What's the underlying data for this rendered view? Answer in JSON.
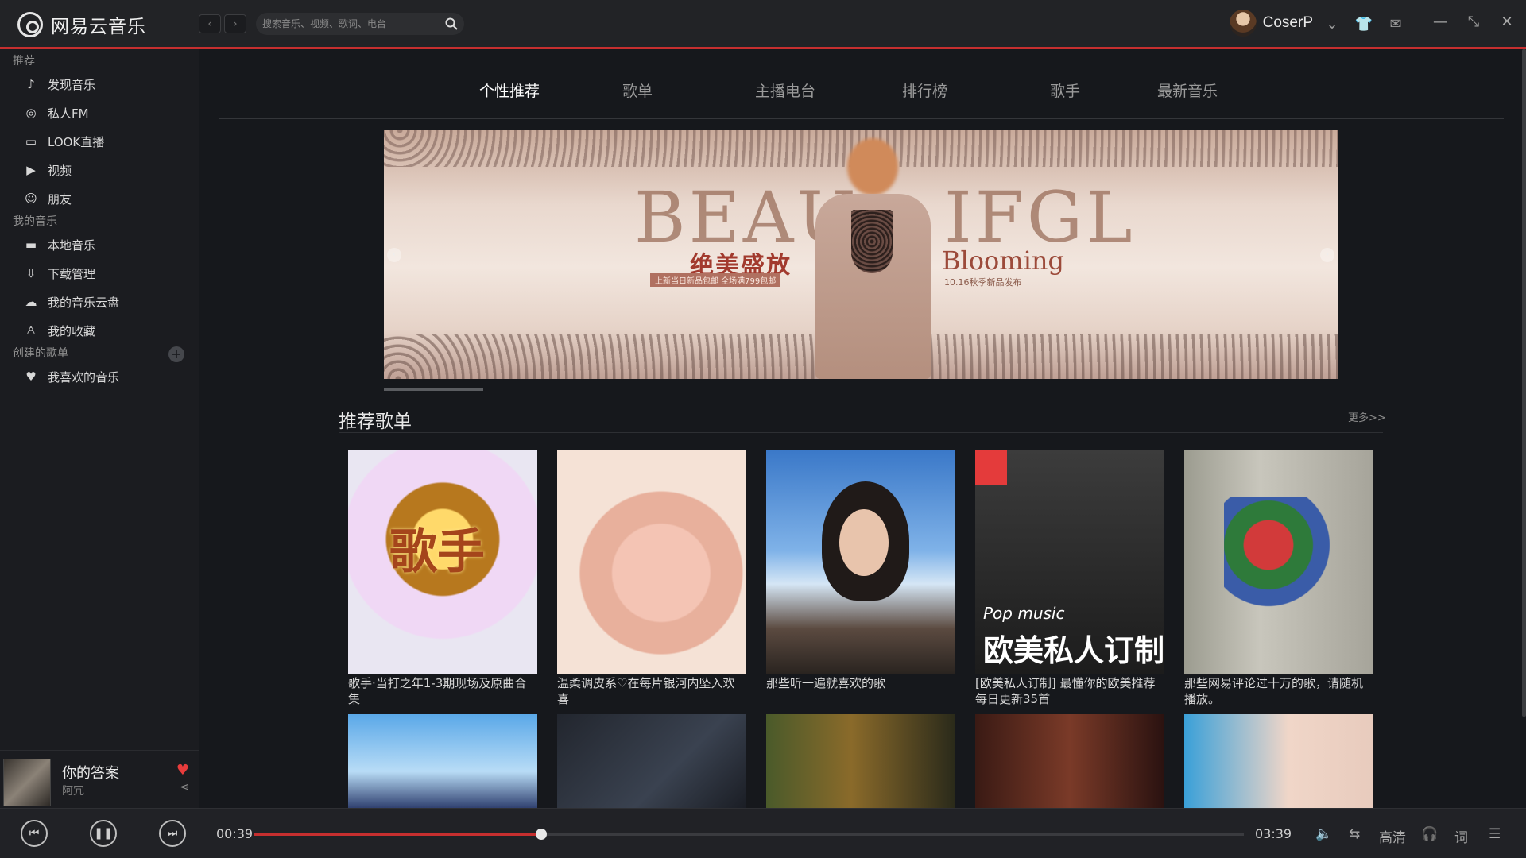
{
  "app": {
    "name": "网易云音乐"
  },
  "search": {
    "placeholder": "搜索音乐、视频、歌词、电台"
  },
  "user": {
    "name": "CoserP"
  },
  "sidebar": {
    "section_recommend": "推荐",
    "recommend_items": [
      {
        "label": "发现音乐",
        "icon": "music-note-icon"
      },
      {
        "label": "私人FM",
        "icon": "radio-icon"
      },
      {
        "label": "LOOK直播",
        "icon": "live-icon"
      },
      {
        "label": "视频",
        "icon": "video-icon"
      },
      {
        "label": "朋友",
        "icon": "friends-icon"
      }
    ],
    "section_my_music": "我的音乐",
    "my_items": [
      {
        "label": "本地音乐",
        "icon": "folder-icon"
      },
      {
        "label": "下载管理",
        "icon": "download-icon"
      },
      {
        "label": "我的音乐云盘",
        "icon": "cloud-icon"
      },
      {
        "label": "我的收藏",
        "icon": "user-icon"
      }
    ],
    "section_created": "创建的歌单",
    "created_items": [
      {
        "label": "我喜欢的音乐",
        "icon": "heart-icon"
      }
    ]
  },
  "now_playing": {
    "title": "你的答案",
    "artist": "阿冗"
  },
  "tabs": [
    {
      "label": "个性推荐",
      "active": true
    },
    {
      "label": "歌单",
      "active": false
    },
    {
      "label": "主播电台",
      "active": false
    },
    {
      "label": "排行榜",
      "active": false
    },
    {
      "label": "歌手",
      "active": false
    },
    {
      "label": "最新音乐",
      "active": false
    }
  ],
  "banner": {
    "word_left": "BEAU",
    "word_right": "IFGL",
    "cn_title": "绝美盛放",
    "small_text": "上新当日新品包邮   全场满799包邮",
    "bloom": "Blooming",
    "date_text": "10.16秋季新品发布"
  },
  "recommend": {
    "title": "推荐歌单",
    "more": "更多>>",
    "playlists": [
      {
        "title": "歌手·当打之年1-3期现场及原曲合集"
      },
      {
        "title": "温柔调皮系♡在每片银河内坠入欢喜"
      },
      {
        "title": "那些听一遍就喜欢的歌"
      },
      {
        "title": "[欧美私人订制] 最懂你的欧美推荐 每日更新35首",
        "overlay_en": "Pop music",
        "overlay_cn": "欧美私人订制"
      },
      {
        "title": "那些网易评论过十万的歌，请随机播放。"
      }
    ]
  },
  "player": {
    "elapsed": "00:39",
    "duration": "03:39",
    "progress": 0.29,
    "quality": "高清",
    "lyrics": "词"
  },
  "colors": {
    "accent": "#c62f2f",
    "bg": "#16181c",
    "sidebar": "#1b1c20"
  }
}
